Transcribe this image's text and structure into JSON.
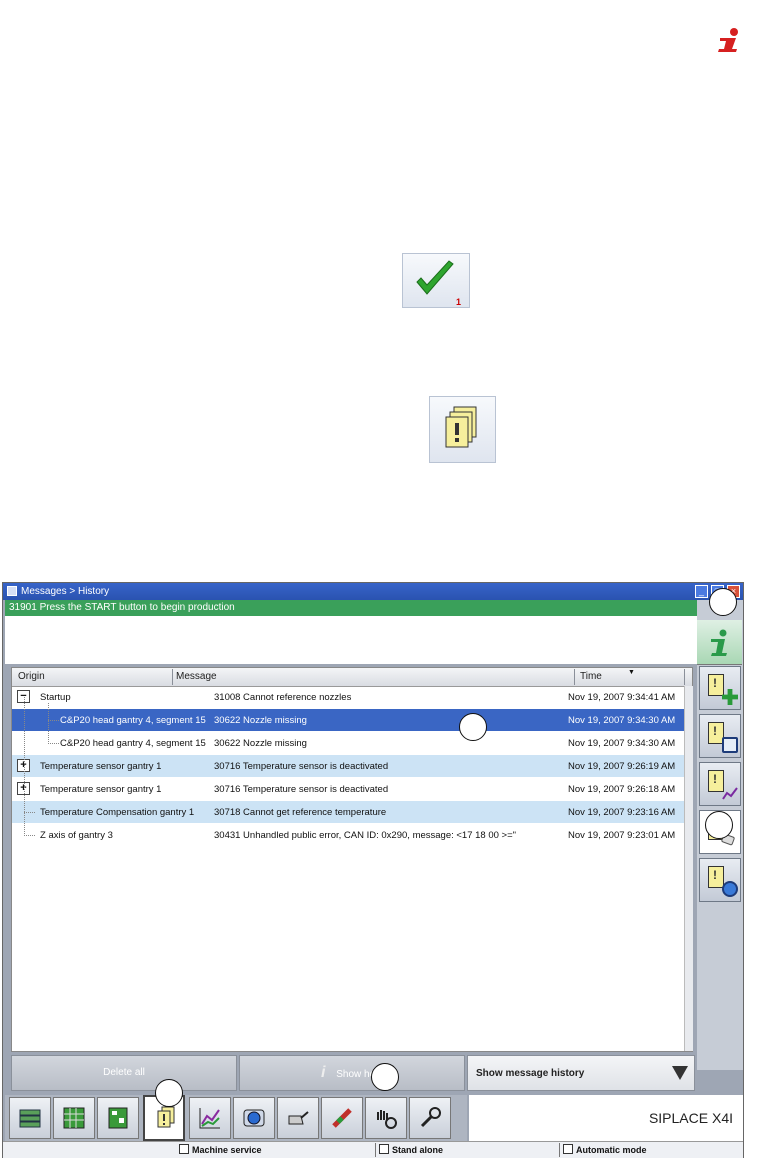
{
  "window": {
    "title": "Messages > History",
    "status_message": "31901 Press the START button to begin production"
  },
  "table": {
    "columns": [
      "Origin",
      "Message",
      "Time"
    ],
    "rows": [
      {
        "origin": "Startup",
        "message": "31008 Cannot reference nozzles",
        "time": "Nov 19, 2007 9:34:41 AM",
        "toggle": "−",
        "state": "normal"
      },
      {
        "origin": "C&P20 head gantry 4, segment 15",
        "message": "30622 Nozzle missing",
        "time": "Nov 19, 2007 9:34:30 AM",
        "toggle": "",
        "state": "selected"
      },
      {
        "origin": "C&P20 head gantry 4, segment 15",
        "message": "30622 Nozzle missing",
        "time": "Nov 19, 2007 9:34:30 AM",
        "toggle": "",
        "state": "normal"
      },
      {
        "origin": "Temperature sensor gantry 1",
        "message": "30716 Temperature sensor is deactivated",
        "time": "Nov 19, 2007 9:26:19 AM",
        "toggle": "+",
        "state": "light"
      },
      {
        "origin": "Temperature sensor gantry 1",
        "message": "30716 Temperature sensor is deactivated",
        "time": "Nov 19, 2007 9:26:18 AM",
        "toggle": "+",
        "state": "normal"
      },
      {
        "origin": "Temperature Compensation gantry 1",
        "message": "30718 Cannot get reference temperature",
        "time": "Nov 19, 2007 9:23:16 AM",
        "toggle": "",
        "state": "light"
      },
      {
        "origin": "Z axis of gantry 3",
        "message": "30431 Unhandled public error, CAN ID: 0x290, message: <17 18 00 >=\"",
        "time": "Nov 19, 2007 9:23:01 AM",
        "toggle": "",
        "state": "normal"
      }
    ]
  },
  "buttons": {
    "delete_all": "Delete all",
    "show_help": "Show help",
    "history_dropdown": "Show message history"
  },
  "brand": "SIPLACE X4I",
  "footer": {
    "mode1": "Machine service",
    "mode2": "Stand alone",
    "mode3": "Automatic mode"
  },
  "decor": {
    "check_sub": "1"
  },
  "colors": {
    "status_green": "#3aa05a",
    "selection_blue": "#3a66c4",
    "highlight_row": "#cce3f5",
    "info_red": "#d62020"
  },
  "icons": {
    "top_info": "info-icon",
    "check": "check-icon",
    "messages": "messages-icon"
  }
}
